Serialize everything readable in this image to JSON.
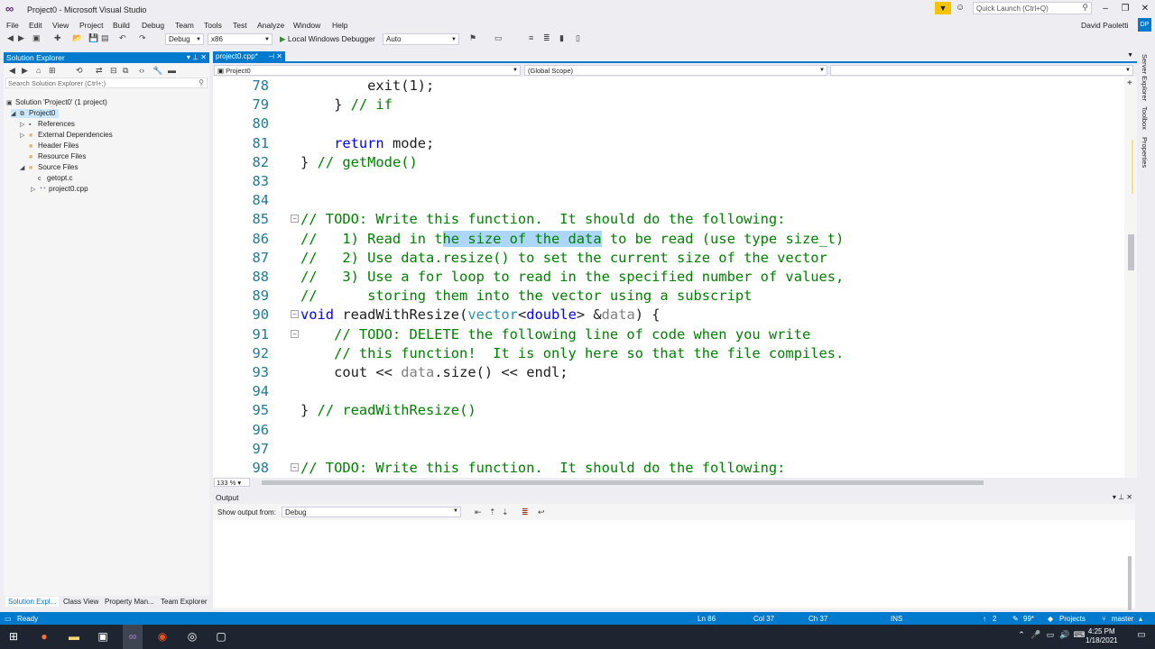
{
  "window": {
    "title": "Project0 - Microsoft Visual Studio",
    "quick_launch_placeholder": "Quick Launch (Ctrl+Q)",
    "user": "David Paoletti",
    "user_initials": "DP"
  },
  "menu": [
    "File",
    "Edit",
    "View",
    "Project",
    "Build",
    "Debug",
    "Team",
    "Tools",
    "Test",
    "Analyze",
    "Window",
    "Help"
  ],
  "toolbar": {
    "configuration": "Debug",
    "platform": "x86",
    "run_label": "Local Windows Debugger",
    "run_mode": "Auto"
  },
  "solution_explorer": {
    "title": "Solution Explorer",
    "search_placeholder": "Search Solution Explorer (Ctrl+;)",
    "tree": [
      {
        "label": "Solution 'Project0' (1 project)"
      },
      {
        "label": "Project0"
      },
      {
        "label": "References"
      },
      {
        "label": "External Dependencies"
      },
      {
        "label": "Header Files"
      },
      {
        "label": "Resource Files"
      },
      {
        "label": "Source Files"
      },
      {
        "label": "getopt.c"
      },
      {
        "label": "project0.cpp"
      }
    ],
    "tabs": [
      "Solution Expl...",
      "Class View",
      "Property Man...",
      "Team Explorer"
    ]
  },
  "right_strip": [
    "Server Explorer",
    "Toolbox",
    "Properties"
  ],
  "editor": {
    "tab_label": "project0.cpp*",
    "nav_project": "Project0",
    "nav_scope": "(Global Scope)",
    "zoom": "133 %",
    "lines": [
      {
        "n": "78",
        "tokens": [
          {
            "t": "        exit(1);",
            "c": ""
          }
        ]
      },
      {
        "n": "79",
        "tokens": [
          {
            "t": "    } ",
            "c": ""
          },
          {
            "t": "// if",
            "c": "cm"
          }
        ]
      },
      {
        "n": "80",
        "tokens": []
      },
      {
        "n": "81",
        "tokens": [
          {
            "t": "    ",
            "c": ""
          },
          {
            "t": "return",
            "c": "kw"
          },
          {
            "t": " mode;",
            "c": ""
          }
        ]
      },
      {
        "n": "82",
        "tokens": [
          {
            "t": "} ",
            "c": ""
          },
          {
            "t": "// getMode()",
            "c": "cm"
          }
        ]
      },
      {
        "n": "83",
        "tokens": []
      },
      {
        "n": "84",
        "tokens": []
      },
      {
        "n": "85",
        "fold": "-",
        "tokens": [
          {
            "t": "// TODO: Write this function.  It should do the following:",
            "c": "cm"
          }
        ]
      },
      {
        "n": "86",
        "tokens": [
          {
            "t": "//   1) Read in t",
            "c": "cm"
          },
          {
            "t": "he size of the data",
            "c": "cm hl"
          },
          {
            "t": " to be read (use type size_t)",
            "c": "cm"
          }
        ]
      },
      {
        "n": "87",
        "tokens": [
          {
            "t": "//   2) Use data.resize() to set the current size of the vector",
            "c": "cm"
          }
        ]
      },
      {
        "n": "88",
        "tokens": [
          {
            "t": "//   3) Use a for loop to read in the specified number of values,",
            "c": "cm"
          }
        ]
      },
      {
        "n": "89",
        "tokens": [
          {
            "t": "//      storing them into the vector using a subscript",
            "c": "cm"
          }
        ]
      },
      {
        "n": "90",
        "fold": "-",
        "tokens": [
          {
            "t": "void",
            "c": "kw"
          },
          {
            "t": " readWithResize(",
            "c": ""
          },
          {
            "t": "vector",
            "c": "ty"
          },
          {
            "t": "<",
            "c": ""
          },
          {
            "t": "double",
            "c": "kw"
          },
          {
            "t": "> &",
            "c": ""
          },
          {
            "t": "data",
            "c": "pr"
          },
          {
            "t": ") {",
            "c": ""
          }
        ]
      },
      {
        "n": "91",
        "fold": "-",
        "tokens": [
          {
            "t": "    // TODO: DELETE the following line of code when you write",
            "c": "cm"
          }
        ]
      },
      {
        "n": "92",
        "tokens": [
          {
            "t": "    // this function!  It is only here so that the file compiles.",
            "c": "cm"
          }
        ]
      },
      {
        "n": "93",
        "tokens": [
          {
            "t": "    cout << ",
            "c": ""
          },
          {
            "t": "data",
            "c": "pr"
          },
          {
            "t": ".size() << endl;",
            "c": ""
          }
        ]
      },
      {
        "n": "94",
        "tokens": []
      },
      {
        "n": "95",
        "tokens": [
          {
            "t": "} ",
            "c": ""
          },
          {
            "t": "// readWithResize()",
            "c": "cm"
          }
        ]
      },
      {
        "n": "96",
        "tokens": []
      },
      {
        "n": "97",
        "tokens": []
      },
      {
        "n": "98",
        "fold": "-",
        "tokens": [
          {
            "t": "// TODO: Write this function.  It should do the following:",
            "c": "cm"
          }
        ]
      }
    ]
  },
  "output": {
    "title": "Output",
    "show_from_label": "Show output from:",
    "source": "Debug"
  },
  "status": {
    "ready": "Ready",
    "ln": "Ln 86",
    "col": "Col 37",
    "ch": "Ch 37",
    "ins": "INS",
    "up": "2",
    "edits": "99*",
    "projects": "Projects",
    "branch": "master"
  },
  "taskbar": {
    "time": "4:25 PM",
    "date": "1/18/2021"
  }
}
